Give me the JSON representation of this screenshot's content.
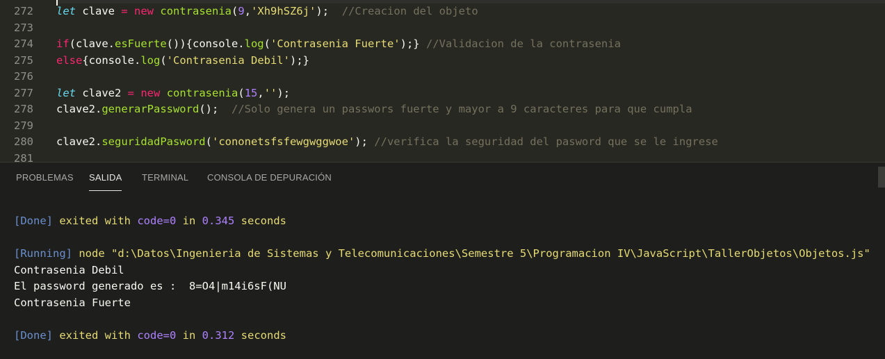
{
  "editor": {
    "lines": [
      {
        "num": "272",
        "tokens": [
          {
            "t": "let",
            "c": "kw-it"
          },
          {
            "t": " clave ",
            "c": ""
          },
          {
            "t": "=",
            "c": "kw"
          },
          {
            "t": " ",
            "c": ""
          },
          {
            "t": "new",
            "c": "kw"
          },
          {
            "t": " ",
            "c": ""
          },
          {
            "t": "contrasenia",
            "c": "fn"
          },
          {
            "t": "(",
            "c": ""
          },
          {
            "t": "9",
            "c": "num"
          },
          {
            "t": ",",
            "c": ""
          },
          {
            "t": "'Xh9hSZ6j'",
            "c": "str"
          },
          {
            "t": ");  ",
            "c": ""
          },
          {
            "t": "//Creacion del objeto",
            "c": "cm"
          }
        ]
      },
      {
        "num": "273",
        "tokens": []
      },
      {
        "num": "274",
        "tokens": [
          {
            "t": "if",
            "c": "kw"
          },
          {
            "t": "(clave.",
            "c": ""
          },
          {
            "t": "esFuerte",
            "c": "fn"
          },
          {
            "t": "()){console.",
            "c": ""
          },
          {
            "t": "log",
            "c": "fn"
          },
          {
            "t": "(",
            "c": ""
          },
          {
            "t": "'Contrasenia Fuerte'",
            "c": "str"
          },
          {
            "t": ");} ",
            "c": ""
          },
          {
            "t": "//Validacion de la contrasenia",
            "c": "cm"
          }
        ]
      },
      {
        "num": "275",
        "tokens": [
          {
            "t": "else",
            "c": "kw"
          },
          {
            "t": "{console.",
            "c": ""
          },
          {
            "t": "log",
            "c": "fn"
          },
          {
            "t": "(",
            "c": ""
          },
          {
            "t": "'Contrasenia Debil'",
            "c": "str"
          },
          {
            "t": ");}",
            "c": ""
          }
        ]
      },
      {
        "num": "276",
        "tokens": []
      },
      {
        "num": "277",
        "tokens": [
          {
            "t": "let",
            "c": "kw-it"
          },
          {
            "t": " clave2 ",
            "c": ""
          },
          {
            "t": "=",
            "c": "kw"
          },
          {
            "t": " ",
            "c": ""
          },
          {
            "t": "new",
            "c": "kw"
          },
          {
            "t": " ",
            "c": ""
          },
          {
            "t": "contrasenia",
            "c": "fn"
          },
          {
            "t": "(",
            "c": ""
          },
          {
            "t": "15",
            "c": "num"
          },
          {
            "t": ",",
            "c": ""
          },
          {
            "t": "''",
            "c": "str"
          },
          {
            "t": ");",
            "c": ""
          }
        ]
      },
      {
        "num": "278",
        "tokens": [
          {
            "t": "clave2.",
            "c": ""
          },
          {
            "t": "generarPassword",
            "c": "fn"
          },
          {
            "t": "();  ",
            "c": ""
          },
          {
            "t": "//Solo genera un passwors fuerte y mayor a 9 caracteres para que cumpla",
            "c": "cm"
          }
        ]
      },
      {
        "num": "279",
        "tokens": []
      },
      {
        "num": "280",
        "tokens": [
          {
            "t": "clave2.",
            "c": ""
          },
          {
            "t": "seguridadPasword",
            "c": "fn"
          },
          {
            "t": "(",
            "c": ""
          },
          {
            "t": "'cononetsfsfewgwggwoe'",
            "c": "str"
          },
          {
            "t": "); ",
            "c": ""
          },
          {
            "t": "//verifica la seguridad del pasword que se le ingrese",
            "c": "cm"
          }
        ]
      },
      {
        "num": "281",
        "tokens": []
      }
    ]
  },
  "panel": {
    "tabs": [
      "PROBLEMAS",
      "SALIDA",
      "TERMINAL",
      "CONSOLA DE DEPURACIÓN"
    ],
    "active_tab": "SALIDA"
  },
  "output": {
    "lines": [
      {
        "tokens": [
          {
            "t": "[Done]",
            "c": "o-blue"
          },
          {
            "t": " exited with ",
            "c": "o-yellow"
          },
          {
            "t": "code=0",
            "c": "o-purple"
          },
          {
            "t": " in ",
            "c": "o-yellow"
          },
          {
            "t": "0.345",
            "c": "o-purple"
          },
          {
            "t": " seconds",
            "c": "o-yellow"
          }
        ]
      },
      {
        "tokens": []
      },
      {
        "tokens": [
          {
            "t": "[Running]",
            "c": "o-blue"
          },
          {
            "t": " node \"d:\\Datos\\Ingenieria de Sistemas y Telecomunicaciones\\Semestre 5\\Programacion IV\\JavaScript\\TallerObjetos\\Objetos.js\"",
            "c": "o-yellow"
          }
        ]
      },
      {
        "tokens": [
          {
            "t": "Contrasenia Debil",
            "c": ""
          }
        ]
      },
      {
        "tokens": [
          {
            "t": "El password generado es :  8=O4|m14i6sF(NU",
            "c": ""
          }
        ]
      },
      {
        "tokens": [
          {
            "t": "Contrasenia Fuerte",
            "c": ""
          }
        ]
      },
      {
        "tokens": []
      },
      {
        "tokens": [
          {
            "t": "[Done]",
            "c": "o-blue"
          },
          {
            "t": " exited with ",
            "c": "o-yellow"
          },
          {
            "t": "code=0",
            "c": "o-purple"
          },
          {
            "t": " in ",
            "c": "o-yellow"
          },
          {
            "t": "0.312",
            "c": "o-purple"
          },
          {
            "t": " seconds",
            "c": "o-yellow"
          }
        ]
      }
    ]
  }
}
